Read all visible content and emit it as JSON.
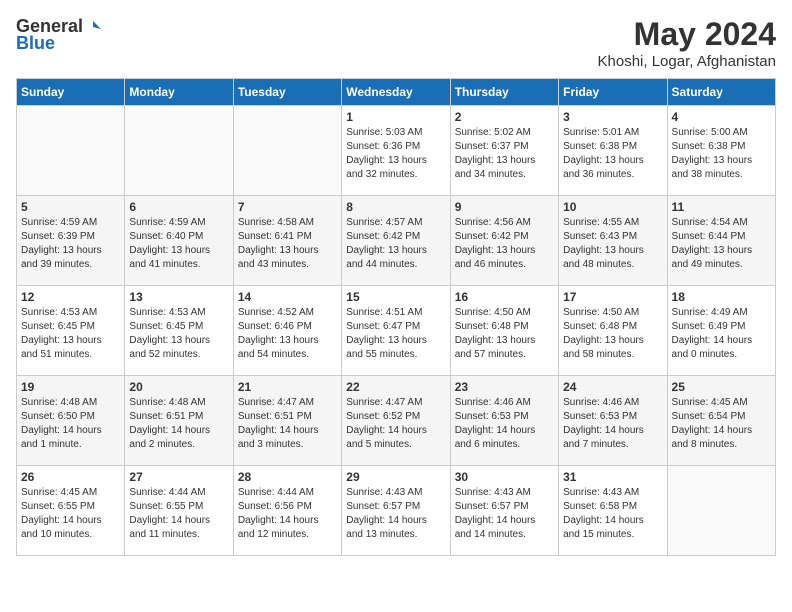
{
  "logo": {
    "general": "General",
    "blue": "Blue"
  },
  "header": {
    "month": "May 2024",
    "location": "Khoshi, Logar, Afghanistan"
  },
  "days_of_week": [
    "Sunday",
    "Monday",
    "Tuesday",
    "Wednesday",
    "Thursday",
    "Friday",
    "Saturday"
  ],
  "weeks": [
    [
      {
        "num": "",
        "info": ""
      },
      {
        "num": "",
        "info": ""
      },
      {
        "num": "",
        "info": ""
      },
      {
        "num": "1",
        "info": "Sunrise: 5:03 AM\nSunset: 6:36 PM\nDaylight: 13 hours\nand 32 minutes."
      },
      {
        "num": "2",
        "info": "Sunrise: 5:02 AM\nSunset: 6:37 PM\nDaylight: 13 hours\nand 34 minutes."
      },
      {
        "num": "3",
        "info": "Sunrise: 5:01 AM\nSunset: 6:38 PM\nDaylight: 13 hours\nand 36 minutes."
      },
      {
        "num": "4",
        "info": "Sunrise: 5:00 AM\nSunset: 6:38 PM\nDaylight: 13 hours\nand 38 minutes."
      }
    ],
    [
      {
        "num": "5",
        "info": "Sunrise: 4:59 AM\nSunset: 6:39 PM\nDaylight: 13 hours\nand 39 minutes."
      },
      {
        "num": "6",
        "info": "Sunrise: 4:59 AM\nSunset: 6:40 PM\nDaylight: 13 hours\nand 41 minutes."
      },
      {
        "num": "7",
        "info": "Sunrise: 4:58 AM\nSunset: 6:41 PM\nDaylight: 13 hours\nand 43 minutes."
      },
      {
        "num": "8",
        "info": "Sunrise: 4:57 AM\nSunset: 6:42 PM\nDaylight: 13 hours\nand 44 minutes."
      },
      {
        "num": "9",
        "info": "Sunrise: 4:56 AM\nSunset: 6:42 PM\nDaylight: 13 hours\nand 46 minutes."
      },
      {
        "num": "10",
        "info": "Sunrise: 4:55 AM\nSunset: 6:43 PM\nDaylight: 13 hours\nand 48 minutes."
      },
      {
        "num": "11",
        "info": "Sunrise: 4:54 AM\nSunset: 6:44 PM\nDaylight: 13 hours\nand 49 minutes."
      }
    ],
    [
      {
        "num": "12",
        "info": "Sunrise: 4:53 AM\nSunset: 6:45 PM\nDaylight: 13 hours\nand 51 minutes."
      },
      {
        "num": "13",
        "info": "Sunrise: 4:53 AM\nSunset: 6:45 PM\nDaylight: 13 hours\nand 52 minutes."
      },
      {
        "num": "14",
        "info": "Sunrise: 4:52 AM\nSunset: 6:46 PM\nDaylight: 13 hours\nand 54 minutes."
      },
      {
        "num": "15",
        "info": "Sunrise: 4:51 AM\nSunset: 6:47 PM\nDaylight: 13 hours\nand 55 minutes."
      },
      {
        "num": "16",
        "info": "Sunrise: 4:50 AM\nSunset: 6:48 PM\nDaylight: 13 hours\nand 57 minutes."
      },
      {
        "num": "17",
        "info": "Sunrise: 4:50 AM\nSunset: 6:48 PM\nDaylight: 13 hours\nand 58 minutes."
      },
      {
        "num": "18",
        "info": "Sunrise: 4:49 AM\nSunset: 6:49 PM\nDaylight: 14 hours\nand 0 minutes."
      }
    ],
    [
      {
        "num": "19",
        "info": "Sunrise: 4:48 AM\nSunset: 6:50 PM\nDaylight: 14 hours\nand 1 minute."
      },
      {
        "num": "20",
        "info": "Sunrise: 4:48 AM\nSunset: 6:51 PM\nDaylight: 14 hours\nand 2 minutes."
      },
      {
        "num": "21",
        "info": "Sunrise: 4:47 AM\nSunset: 6:51 PM\nDaylight: 14 hours\nand 3 minutes."
      },
      {
        "num": "22",
        "info": "Sunrise: 4:47 AM\nSunset: 6:52 PM\nDaylight: 14 hours\nand 5 minutes."
      },
      {
        "num": "23",
        "info": "Sunrise: 4:46 AM\nSunset: 6:53 PM\nDaylight: 14 hours\nand 6 minutes."
      },
      {
        "num": "24",
        "info": "Sunrise: 4:46 AM\nSunset: 6:53 PM\nDaylight: 14 hours\nand 7 minutes."
      },
      {
        "num": "25",
        "info": "Sunrise: 4:45 AM\nSunset: 6:54 PM\nDaylight: 14 hours\nand 8 minutes."
      }
    ],
    [
      {
        "num": "26",
        "info": "Sunrise: 4:45 AM\nSunset: 6:55 PM\nDaylight: 14 hours\nand 10 minutes."
      },
      {
        "num": "27",
        "info": "Sunrise: 4:44 AM\nSunset: 6:55 PM\nDaylight: 14 hours\nand 11 minutes."
      },
      {
        "num": "28",
        "info": "Sunrise: 4:44 AM\nSunset: 6:56 PM\nDaylight: 14 hours\nand 12 minutes."
      },
      {
        "num": "29",
        "info": "Sunrise: 4:43 AM\nSunset: 6:57 PM\nDaylight: 14 hours\nand 13 minutes."
      },
      {
        "num": "30",
        "info": "Sunrise: 4:43 AM\nSunset: 6:57 PM\nDaylight: 14 hours\nand 14 minutes."
      },
      {
        "num": "31",
        "info": "Sunrise: 4:43 AM\nSunset: 6:58 PM\nDaylight: 14 hours\nand 15 minutes."
      },
      {
        "num": "",
        "info": ""
      }
    ]
  ]
}
